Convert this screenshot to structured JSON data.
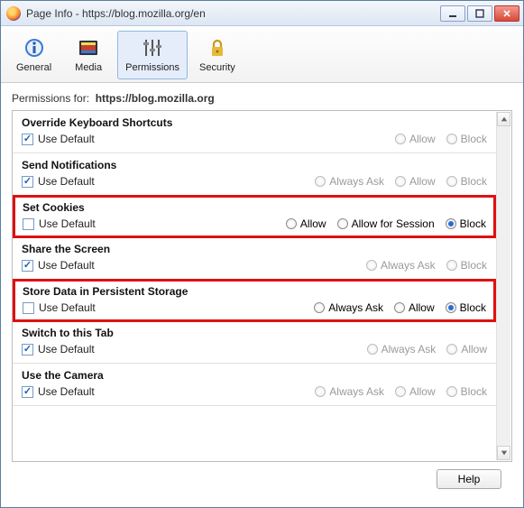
{
  "window": {
    "title": "Page Info - https://blog.mozilla.org/en"
  },
  "toolbar": {
    "general": "General",
    "media": "Media",
    "permissions": "Permissions",
    "security": "Security"
  },
  "header": {
    "label": "Permissions for:",
    "url": "https://blog.mozilla.org"
  },
  "useDefaultLabel": "Use Default",
  "options": {
    "allow": "Allow",
    "block": "Block",
    "alwaysAsk": "Always Ask",
    "allowSession": "Allow for Session"
  },
  "rows": {
    "overrideKeyboard": {
      "title": "Override Keyboard Shortcuts"
    },
    "sendNotifications": {
      "title": "Send Notifications"
    },
    "setCookies": {
      "title": "Set Cookies"
    },
    "shareScreen": {
      "title": "Share the Screen"
    },
    "persistentStorage": {
      "title": "Store Data in Persistent Storage"
    },
    "switchTab": {
      "title": "Switch to this Tab"
    },
    "useCamera": {
      "title": "Use the Camera"
    }
  },
  "footer": {
    "help": "Help"
  }
}
